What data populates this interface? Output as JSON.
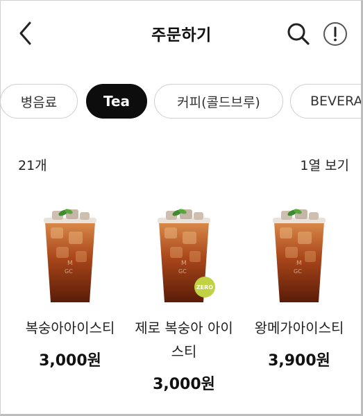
{
  "header": {
    "title": "주문하기",
    "back_icon": "chevron-left-icon",
    "search_icon": "search-icon",
    "info_icon": "info-icon"
  },
  "categories": [
    {
      "label": "병음료",
      "active": false
    },
    {
      "label": "Tea",
      "active": true
    },
    {
      "label": "커피(콜드브루)",
      "active": false
    },
    {
      "label": "BEVERA",
      "active": false
    }
  ],
  "list": {
    "count": "21개",
    "view_toggle": "1열 보기"
  },
  "products": [
    {
      "name": "복숭아아이스티",
      "price": "3,000원",
      "badge": ""
    },
    {
      "name": "제로 복숭아 아이스티",
      "price": "3,000원",
      "badge": "ZERO"
    },
    {
      "name": "왕메가아이스티",
      "price": "3,900원",
      "badge": ""
    }
  ],
  "colors": {
    "active_chip": "#0d0d0d",
    "zero_badge": "#c1d144",
    "tea": "#9a3d12"
  }
}
